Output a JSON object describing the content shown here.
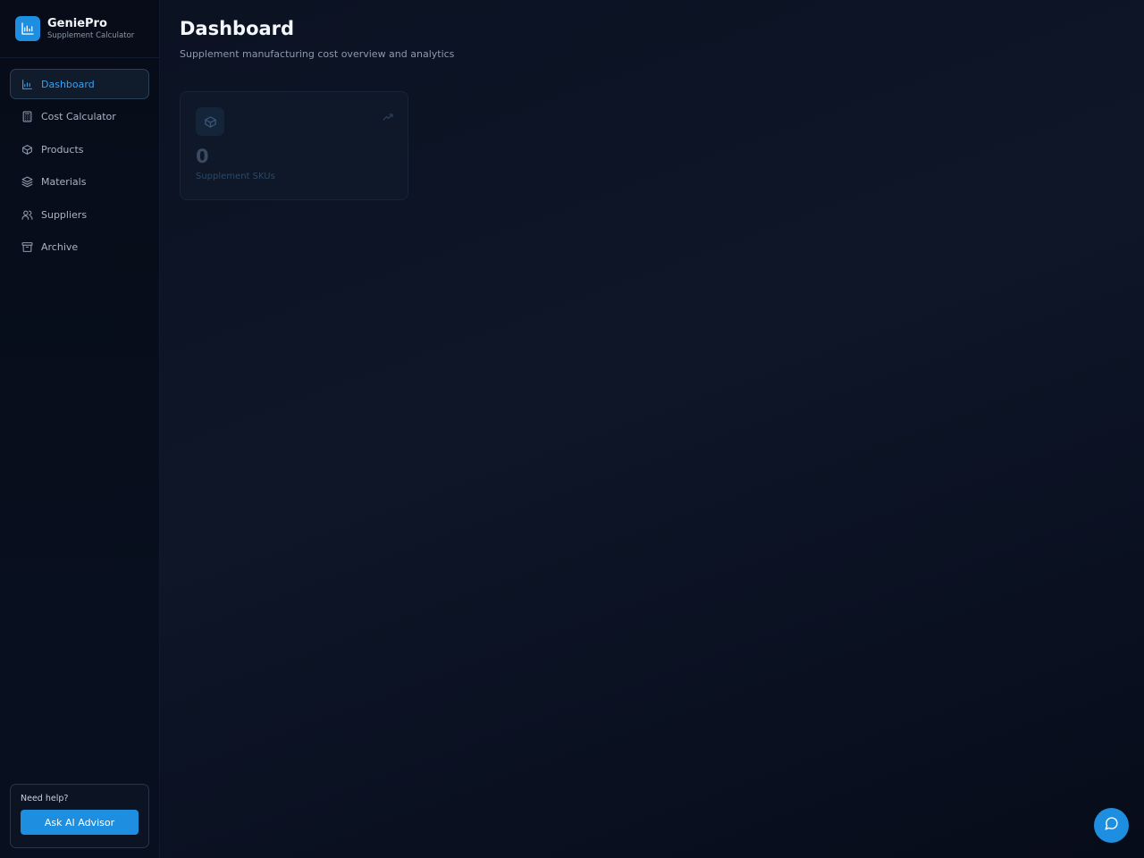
{
  "brand": {
    "name": "GeniePro",
    "subtitle": "Supplement Calculator",
    "logo_icon": "factory-chart-icon",
    "accent_color": "#1e8fe0"
  },
  "sidebar": {
    "items": [
      {
        "label": "Dashboard",
        "icon": "chart-icon",
        "active": true
      },
      {
        "label": "Cost Calculator",
        "icon": "calculator-icon",
        "active": false
      },
      {
        "label": "Products",
        "icon": "package-icon",
        "active": false
      },
      {
        "label": "Materials",
        "icon": "layers-icon",
        "active": false
      },
      {
        "label": "Suppliers",
        "icon": "users-icon",
        "active": false
      },
      {
        "label": "Archive",
        "icon": "archive-icon",
        "active": false
      }
    ],
    "help": {
      "title": "Need help?",
      "button_label": "Ask AI Advisor"
    }
  },
  "header": {
    "title": "Dashboard",
    "subtitle": "Supplement manufacturing cost overview and analytics"
  },
  "stats": [
    {
      "value": "0",
      "label": "Supplement SKUs",
      "icon": "package-icon",
      "trend_icon": "trending-up-icon"
    }
  ],
  "chat_button": {
    "icon": "chat-bubble-icon"
  }
}
